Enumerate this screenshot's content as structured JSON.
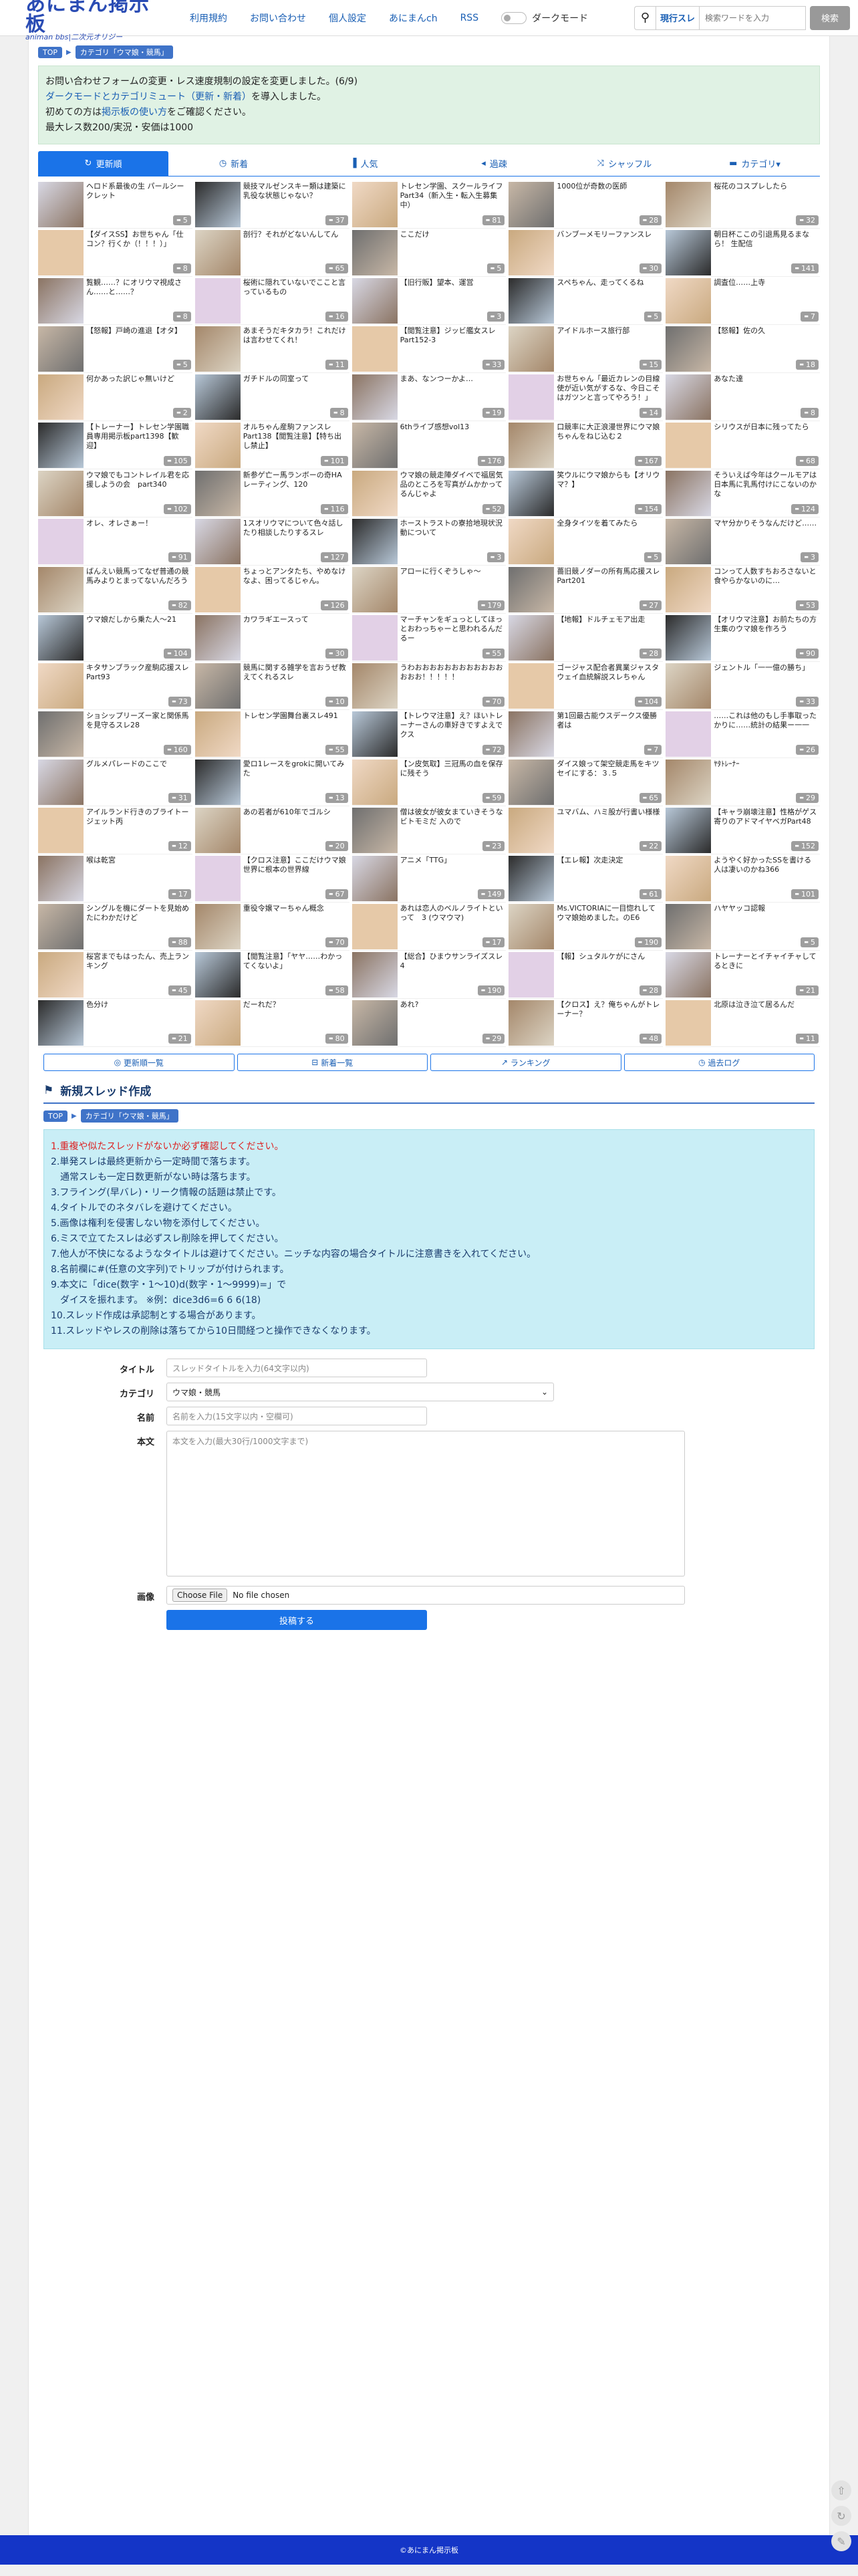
{
  "header": {
    "logo_title": "あにまん掲示板",
    "logo_subtitle": "animan bbs|二次元オリジー",
    "nav": [
      "利用規約",
      "お問い合わせ",
      "個人設定",
      "あにまんch",
      "RSS"
    ],
    "dark_mode_label": "ダークモード",
    "search_scope": "現行スレ",
    "search_placeholder": "検索ワードを入力",
    "search_button": "検索"
  },
  "breadcrumb": {
    "top": "TOP",
    "category": "カテゴリ「ウマ娘・競馬」"
  },
  "notice": {
    "line1": "お問い合わせフォームの変更・レス速度規制の設定を変更しました。(6/9)",
    "line2_link": "ダークモードとカテゴリミュート（更新・新着）",
    "line2_rest": "を導入しました。",
    "line3_pre": "初めての方は",
    "line3_link": "掲示板の使い方",
    "line3_post": "をご確認ください。",
    "line4": "最大レス数200/実況・安価は1000"
  },
  "tabs": [
    {
      "label": "更新順",
      "icon": "refresh-icon",
      "glyph": "↻"
    },
    {
      "label": "新着",
      "icon": "clock-icon",
      "glyph": "◷"
    },
    {
      "label": "人気",
      "icon": "bar-chart-icon",
      "glyph": "▐"
    },
    {
      "label": "過疎",
      "icon": "speaker-icon",
      "glyph": "◂"
    },
    {
      "label": "シャッフル",
      "icon": "shuffle-icon",
      "glyph": "⤨"
    },
    {
      "label": "カテゴリ▾",
      "icon": "folder-icon",
      "glyph": "▬"
    }
  ],
  "threads": [
    {
      "title": "ヘロド系最後の生 パールシークレット",
      "count": "5"
    },
    {
      "title": "競技マルゼンスキー類は建築に乳役な状態じゃない？",
      "count": "37"
    },
    {
      "title": "トレセン学園、スクールライフPart34（新入生・転入生募集中）",
      "count": "81"
    },
    {
      "title": "1000位が奇数の医師",
      "count": "28"
    },
    {
      "title": "桜花のコスプレしたら",
      "count": "32"
    },
    {
      "title": "【ダイスSS】お世ちゃん「仕コン？行くか（！！！）」",
      "count": "8"
    },
    {
      "title": "剖行？それがどないんしてん",
      "count": "65"
    },
    {
      "title": "ここだけ",
      "count": "5"
    },
    {
      "title": "バンブーメモリーファンスレ",
      "count": "30"
    },
    {
      "title": "朝日杯ここの引退馬見るまなら！ 生配信",
      "count": "141"
    },
    {
      "title": "覧観……？にオリウマ視成さん……と……？",
      "count": "8"
    },
    {
      "title": "桜術に隠れていないでここと言っているもの",
      "count": "16"
    },
    {
      "title": "【旧行販】望本、運営",
      "count": "3"
    },
    {
      "title": "スペちゃん、走ってくるね",
      "count": "5"
    },
    {
      "title": "調査位……上寺",
      "count": "7"
    },
    {
      "title": "【怒報】戸崎の進退【オタ】",
      "count": "5"
    },
    {
      "title": "あまそうだキタカラ！これだけは言わせてくれ！",
      "count": "11"
    },
    {
      "title": "【閲覧注意】ジッビ艦女スレPart152-3",
      "count": "33"
    },
    {
      "title": "アイドルホース旅行部",
      "count": "15"
    },
    {
      "title": "【怒報】佐の久",
      "count": "18"
    },
    {
      "title": "何かあった訳じゃ無いけど",
      "count": "2"
    },
    {
      "title": "ガチドルの同室って",
      "count": "8"
    },
    {
      "title": "まあ、なンつーかよ…",
      "count": "19"
    },
    {
      "title": "お世ちゃん「最近カレンの目線使が近い気がするな、今日こそはガツンと言ってやろう！」",
      "count": "14"
    },
    {
      "title": "あなた達",
      "count": "8"
    },
    {
      "title": "【トレーナー】トレセン学園職員専用掲示板part1398【歓迎】",
      "count": "105"
    },
    {
      "title": "オルちゃん産駒ファンスレPart138【閲覧注意】【特ち出し禁止】",
      "count": "101"
    },
    {
      "title": "6thライブ感想vol13",
      "count": "176"
    },
    {
      "title": "口競率に大正浪漫世界にウマ娘ちゃんをねじ込む２",
      "count": "167"
    },
    {
      "title": "シリウスが日本に残ってたら",
      "count": "68"
    },
    {
      "title": "ウマ娘でもコントレイル君を応援しようの会　part340",
      "count": "102"
    },
    {
      "title": "新参ゲ亡ー馬ランボーの奇HAレーティング、120",
      "count": "116"
    },
    {
      "title": "ウマ娘の競走陣ダイベで福居気品のところを写真がムかかってるんじゃよ",
      "count": "52"
    },
    {
      "title": "笑ウルにウマ娘からも【オリウマ？】",
      "count": "154"
    },
    {
      "title": "そういえば今年はクールモアは日本馬に乳馬付けにこないのかな",
      "count": "124"
    },
    {
      "title": "オレ、オレさぁー！",
      "count": "91"
    },
    {
      "title": "1スオリウマについて色々話したり相談したりするスレ",
      "count": "127"
    },
    {
      "title": "ホーストラストの寮拾地現状況動について",
      "count": "3"
    },
    {
      "title": "全身タイツを着てみたら",
      "count": "5"
    },
    {
      "title": "マヤ分かりそうなんだけど……",
      "count": "3"
    },
    {
      "title": "ばんえい競馬ってなぜ普通の競馬みよりとまってないんだろう",
      "count": "82"
    },
    {
      "title": "ちょっとアンタたち、やめなけなよ、困ってるじゃん。",
      "count": "126"
    },
    {
      "title": "アローに行くぞうしゃ〜",
      "count": "179"
    },
    {
      "title": "薔旧競ノダーの所有馬応援スレPart201",
      "count": "27"
    },
    {
      "title": "コンって人数すちおろさないと食やらかないのに…",
      "count": "53"
    },
    {
      "title": "ウマ娘だしから乗た人〜21",
      "count": "104"
    },
    {
      "title": "カワラギエースって",
      "count": "30"
    },
    {
      "title": "マーチャンをギュっとしてほっとおわっちゃーと思われるんだるー",
      "count": "55"
    },
    {
      "title": "【地報】ドルチェモア出走",
      "count": "28"
    },
    {
      "title": "【オリウマ注意】お前たちの方生集のウマ娘を作ろう",
      "count": "90"
    },
    {
      "title": "キタサンブラック産駒応援スレPart93",
      "count": "73"
    },
    {
      "title": "競馬に関する雑学を言おうぜ教えてくれるスレ",
      "count": "10"
    },
    {
      "title": "うわおおおおおおおおおおおおおおお！！！！！",
      "count": "70"
    },
    {
      "title": "ゴージャス配合者異業ジャスタウェイ血統解説スレちゃん",
      "count": "104"
    },
    {
      "title": "ジェントル「一一億の勝ち」",
      "count": "33"
    },
    {
      "title": "ショシップリーズー家と関係馬を見守るスレ28",
      "count": "160"
    },
    {
      "title": "トレセン学園舞台裏スレ491",
      "count": "55"
    },
    {
      "title": "【トレウマ注意】え？ほいトレーナーさんの車好きですよえでクス",
      "count": "72"
    },
    {
      "title": "第1回最古能ウスデークス優勝者は",
      "count": "7"
    },
    {
      "title": "……これは他のもし手事取ったかりに……統計の結果ー一一",
      "count": "26"
    },
    {
      "title": "グルメパレードのここで",
      "count": "31"
    },
    {
      "title": "愛ロ1レースをgrokに開いてみた",
      "count": "13"
    },
    {
      "title": "【ン皮気取】三冠馬の血を保存に残そう",
      "count": "59"
    },
    {
      "title": "ダイス娘って架空競走馬をキツセイにする：３.５",
      "count": "65"
    },
    {
      "title": "ﾔﾀﾄﾚｰﾅｰ",
      "count": "29"
    },
    {
      "title": "アイルランド行きのブライトージェット丙",
      "count": "12"
    },
    {
      "title": "あの若者が610年でゴルシ",
      "count": "20"
    },
    {
      "title": "僧は彼女が彼女まていきそうなビトモミだ 入ので",
      "count": "23"
    },
    {
      "title": "ユマバム、ハミ股が行書い様様",
      "count": "22"
    },
    {
      "title": "【キャラ崩壊注意】性格がゲス寄りのアドマイヤベガPart48",
      "count": "152"
    },
    {
      "title": "喉は乾宮",
      "count": "17"
    },
    {
      "title": "【クロス注意】ここだけウマ娘世界に根本の世界線",
      "count": "67"
    },
    {
      "title": "アニメ「TTG」",
      "count": "149"
    },
    {
      "title": "【エレ報】次走決定",
      "count": "61"
    },
    {
      "title": "ようやく好かったSSを書ける人は凄いのかね366",
      "count": "101"
    },
    {
      "title": "シングルを機にダートを見始めたにわかだけど",
      "count": "88"
    },
    {
      "title": "重役令嬢マーちゃん概念",
      "count": "70"
    },
    {
      "title": "あれは恋人のベルノライトといって　3 (ウマウマ)",
      "count": "17"
    },
    {
      "title": "Ms.VICTORIAに一目惚れしてウマ娘始めました。のE6",
      "count": "190"
    },
    {
      "title": "ハヤヤッコ認報",
      "count": "5"
    },
    {
      "title": "桜宮までもはったん、売上ランキング",
      "count": "45"
    },
    {
      "title": "【閲覧注意】「ヤヤ……わかってくないよ」",
      "count": "58"
    },
    {
      "title": "【総合】ひまウサンライズスレ4",
      "count": "190"
    },
    {
      "title": "【報】シュタルケがにさん",
      "count": "28"
    },
    {
      "title": "トレーナーとイチャイチャしてるときに",
      "count": "21"
    },
    {
      "title": "色分け",
      "count": "21"
    },
    {
      "title": "だーれだ？",
      "count": "80"
    },
    {
      "title": "あれ?",
      "count": "29"
    },
    {
      "title": "【クロス】え？俺ちゃんがトレーナー？",
      "count": "48"
    },
    {
      "title": "北原は泣き泣て居るんだ",
      "count": "11"
    }
  ],
  "bottom_links": [
    {
      "label": "更新順一覧",
      "icon": "list-icon",
      "glyph": "◎"
    },
    {
      "label": "新着一覧",
      "icon": "new-icon",
      "glyph": "⊟"
    },
    {
      "label": "ランキング",
      "icon": "ranking-icon",
      "glyph": "↗"
    },
    {
      "label": "過去ログ",
      "icon": "log-icon",
      "glyph": "◷"
    }
  ],
  "new_thread": {
    "title": "新規スレッド作成",
    "rules": [
      "1.重複や似たスレッドがないか必ず確認してください。",
      "2.単発スレは最終更新から一定時間で落ちます。",
      "　通常スレも一定日数更新がない時は落ちます。",
      "3.フライング(早バレ)・リーク情報の話題は禁止です。",
      "4.タイトルでのネタバレを避けてください。",
      "5.画像は権利を侵害しない物を添付してください。",
      "6.ミスで立てたスレは必ずスレ削除を押してください。",
      "7.他人が不快になるようなタイトルは避けてください。ニッチな内容の場合タイトルに注意書きを入れてください。",
      "8.名前欄に#(任意の文字列)でトリップが付けられます。",
      "9.本文に「dice(数字・1〜10)d(数字・1〜9999)=」で",
      "　ダイスを振れます。 ※例：dice3d6=6 6 6(18)",
      "10.スレッド作成は承認制とする場合があります。",
      "11.スレッドやレスの削除は落ちてから10日間経つと操作できなくなります。"
    ],
    "labels": {
      "title": "タイトル",
      "category": "カテゴリ",
      "name": "名前",
      "body": "本文",
      "image": "画像"
    },
    "placeholders": {
      "title": "スレッドタイトルを入力(64文字以内)",
      "name": "名前を入力(15文字以内・空欄可)",
      "body": "本文を入力(最大30行/1000文字まで)"
    },
    "category_value": "ウマ娘・競馬",
    "file_button": "Choose File",
    "file_status": "No file chosen",
    "submit": "投稿する"
  },
  "footer": "©あにまん掲示板",
  "colors": {
    "accent": "#1a73e8",
    "notice_bg": "#e0f2e4",
    "rules_bg": "#c9eef6",
    "footer_bg": "#1435c7",
    "count_badge": "#9e9e9e"
  }
}
